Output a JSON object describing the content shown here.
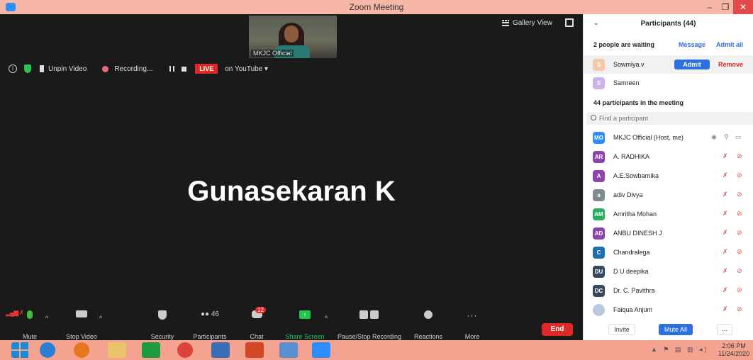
{
  "window": {
    "title": "Zoom Meeting",
    "minimize": "–",
    "maximize": "❐",
    "close": "✕"
  },
  "video": {
    "thumbnail_label": "MKJC Official",
    "gallery_view_label": "Gallery View",
    "unpin_label": "Unpin Video",
    "recording_label": "Recording...",
    "live_label": "LIVE",
    "youtube_label": "on YouTube ▾",
    "active_speaker": "Gunasekaran K"
  },
  "toolbar": {
    "mute": "Mute",
    "stop_video": "Stop Video",
    "security": "Security",
    "participants": "Participants",
    "participants_count": "46",
    "chat": "Chat",
    "chat_badge": "12",
    "share_screen": "Share Screen",
    "pause_recording": "Pause/Stop Recording",
    "reactions": "Reactions",
    "more": "More",
    "end": "End"
  },
  "panel": {
    "title": "Participants (44)",
    "waiting_text": "2 people are waiting",
    "message_label": "Message",
    "admit_all_label": "Admit all",
    "admit_label": "Admit",
    "remove_label": "Remove",
    "waiting": [
      {
        "initial": "S",
        "name": "Sowmiya.v",
        "color": "#f5c9a8"
      },
      {
        "initial": "S",
        "name": "Samreen",
        "color": "#c9b3e8"
      }
    ],
    "in_meeting_text": "44 participants in the meeting",
    "search_placeholder": "Find a participant",
    "participants": [
      {
        "initials": "MO",
        "name": "MKJC Official (Host, me)",
        "color": "#2d8cff"
      },
      {
        "initials": "AR",
        "name": "A. RADHIKA",
        "color": "#8e44ad"
      },
      {
        "initials": "A",
        "name": "A.E.Sowbarnika",
        "color": "#8e44ad"
      },
      {
        "initials": "a",
        "name": "adiv Divya",
        "color": "#7f8c8d"
      },
      {
        "initials": "AM",
        "name": "Amritha Mohan",
        "color": "#27ae60"
      },
      {
        "initials": "AD",
        "name": "ANBU DINESH J",
        "color": "#8e44ad"
      },
      {
        "initials": "C",
        "name": "Chandralega",
        "color": "#1f6fb0"
      },
      {
        "initials": "DU",
        "name": "D U deepika",
        "color": "#34495e"
      },
      {
        "initials": "DC",
        "name": "Dr. C. Pavithra",
        "color": "#34495e"
      },
      {
        "initials": "",
        "name": "Faiqua Anjum",
        "color": "#b9c8dc"
      }
    ],
    "invite_label": "Invite",
    "mute_all_label": "Mute All",
    "more_label": "..."
  },
  "taskbar": {
    "time": "2:06 PM",
    "date": "11/24/2020"
  }
}
